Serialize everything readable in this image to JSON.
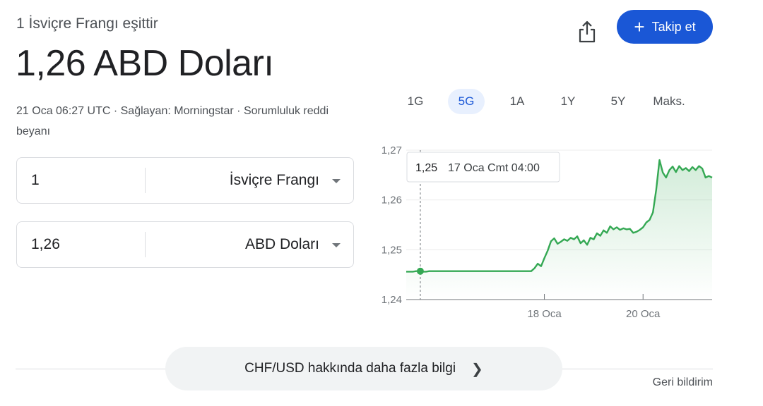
{
  "header": {
    "equals_label": "1 İsviçre Frangı eşittir",
    "main_value": "1,26 ABD Doları",
    "timestamp": "21 Oca 06:27 UTC",
    "separator": " · ",
    "provider": "Sağlayan: Morningstar",
    "disclaimer": "Sorumluluk reddi beyanı"
  },
  "actions": {
    "share_icon": "share-icon",
    "follow_label": "Takip et",
    "follow_color": "#1a57d6"
  },
  "converter": {
    "from": {
      "amount": "1",
      "currency": "İsviçre Frangı"
    },
    "to": {
      "amount": "1,26",
      "currency": "ABD Doları"
    }
  },
  "ranges": {
    "items": [
      "1G",
      "5G",
      "1A",
      "1Y",
      "5Y",
      "Maks."
    ],
    "selected": "5G"
  },
  "chart_data": {
    "type": "area",
    "title": "",
    "xlabel": "",
    "ylabel": "",
    "color": "#34a853",
    "y_ticks": [
      "1,27",
      "1,26",
      "1,25",
      "1,24"
    ],
    "x_ticks": [
      "18 Oca",
      "20 Oca"
    ],
    "ylim": [
      1.24,
      1.27
    ],
    "tooltip": {
      "value": "1,25",
      "time": "17 Oca Cmt 04:00"
    },
    "series": [
      {
        "values": [
          1.2456,
          1.2456,
          1.2456,
          1.2457,
          1.2457,
          1.2456,
          1.2456,
          1.2457,
          1.2457,
          1.2457,
          1.2457,
          1.2457,
          1.2457,
          1.2457,
          1.2457,
          1.2457,
          1.2457,
          1.2457,
          1.2457,
          1.2457,
          1.2457,
          1.2457,
          1.2457,
          1.2457,
          1.2457,
          1.2457,
          1.2457,
          1.2457,
          1.2457,
          1.2457,
          1.2457,
          1.2457,
          1.2457,
          1.2457,
          1.2457,
          1.2457,
          1.2457,
          1.2457,
          1.2457,
          1.2463,
          1.2472,
          1.2467,
          1.2483,
          1.2498,
          1.2517,
          1.2523,
          1.2512,
          1.2516,
          1.2521,
          1.2518,
          1.2524,
          1.2521,
          1.2527,
          1.2513,
          1.2519,
          1.251,
          1.2524,
          1.2521,
          1.2533,
          1.2528,
          1.2539,
          1.2534,
          1.2547,
          1.2541,
          1.2545,
          1.254,
          1.2543,
          1.2541,
          1.2542,
          1.2534,
          1.2536,
          1.254,
          1.2545,
          1.2555,
          1.256,
          1.2575,
          1.262,
          1.268,
          1.2655,
          1.2645,
          1.266,
          1.2667,
          1.2656,
          1.2668,
          1.266,
          1.2664,
          1.2658,
          1.2666,
          1.266,
          1.2668,
          1.2663,
          1.2645,
          1.2648,
          1.2645
        ]
      }
    ]
  },
  "footer": {
    "more_info": "CHF/USD hakkında daha fazla bilgi",
    "feedback": "Geri bildirim"
  }
}
